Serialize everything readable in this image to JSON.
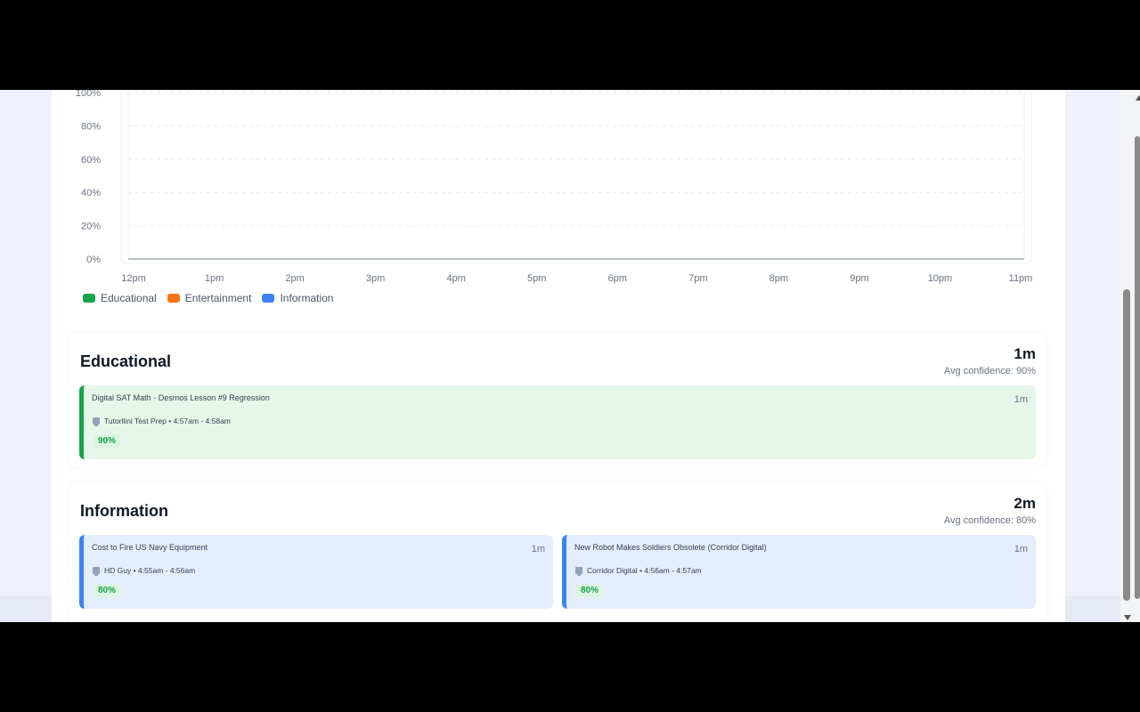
{
  "chart_data": {
    "type": "area",
    "y_ticks": [
      "0%",
      "20%",
      "40%",
      "60%",
      "80%",
      "100%"
    ],
    "x": [
      "12pm",
      "1pm",
      "2pm",
      "3pm",
      "4pm",
      "5pm",
      "6pm",
      "7pm",
      "8pm",
      "9pm",
      "10pm",
      "11pm"
    ],
    "ylim": [
      0,
      100
    ],
    "grid": true,
    "legend_position": "bottom-left",
    "series": [
      {
        "name": "Educational",
        "color": "#16a34a",
        "values": [
          0,
          0,
          0,
          0,
          0,
          0,
          0,
          0,
          0,
          0,
          0,
          0
        ]
      },
      {
        "name": "Entertainment",
        "color": "#f97316",
        "values": [
          0,
          0,
          0,
          0,
          0,
          0,
          0,
          0,
          0,
          0,
          0,
          0
        ]
      },
      {
        "name": "Information",
        "color": "#3b82f6",
        "values": [
          0,
          0,
          0,
          0,
          0,
          0,
          0,
          0,
          0,
          0,
          0,
          0
        ]
      }
    ]
  },
  "legend": {
    "educational": "Educational",
    "entertainment": "Entertainment",
    "information": "Information"
  },
  "sections": {
    "educational": {
      "title": "Educational",
      "total": "1m",
      "avg_confidence": "Avg confidence: 90%",
      "items": [
        {
          "title": "Digital SAT Math - Desmos Lesson #9 Regression",
          "duration": "1m",
          "meta": "Tutorllini Test Prep • 4:57am - 4:58am",
          "confidence": "90%"
        }
      ]
    },
    "information": {
      "title": "Information",
      "total": "2m",
      "avg_confidence": "Avg confidence: 80%",
      "items": [
        {
          "title": "Cost to Fire US Navy Equipment",
          "duration": "1m",
          "meta": "HD Guy • 4:55am - 4:56am",
          "confidence": "80%"
        },
        {
          "title": "New Robot Makes Soldiers Obsolete (Corridor Digital)",
          "duration": "1m",
          "meta": "Corridor Digital • 4:56am - 4:57am",
          "confidence": "80%"
        }
      ]
    }
  },
  "icons": {
    "channel": "channel-icon"
  }
}
